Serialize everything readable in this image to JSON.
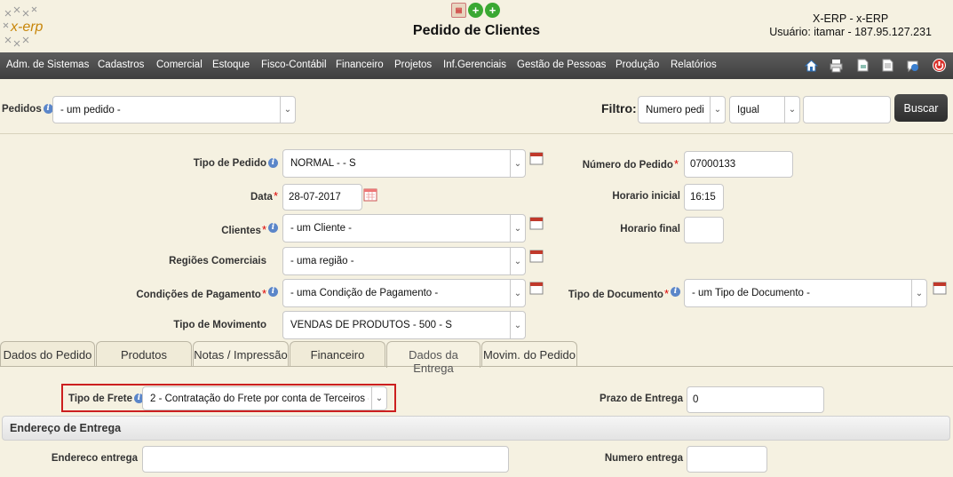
{
  "header": {
    "logo_text": "x-erp",
    "title": "Pedido de Clientes",
    "system_name": "X-ERP - x-ERP",
    "user_line": "Usuário: itamar - 187.95.127.231"
  },
  "menu": {
    "items": [
      "Adm. de Sistemas",
      "Cadastros",
      "Comercial",
      "Estoque",
      "Fisco-Contábil",
      "Financeiro",
      "Projetos",
      "Inf.Gerenciais",
      "Gestão de Pessoas",
      "Produção",
      "Relatórios"
    ]
  },
  "toolbar": {
    "icons": [
      "home-icon",
      "print-icon",
      "export-icon",
      "document-icon",
      "help-icon",
      "exit-icon"
    ]
  },
  "search": {
    "pedidos_label": "Pedidos",
    "pedidos_value": "- um pedido -",
    "filtro_label": "Filtro:",
    "filtro_field": "Numero pedi",
    "filtro_operator": "Igual",
    "filtro_value": "",
    "buscar_label": "Buscar"
  },
  "form": {
    "tipo_pedido_label": "Tipo de Pedido",
    "tipo_pedido_value": "NORMAL - - S",
    "data_label": "Data",
    "data_value": "28-07-2017",
    "clientes_label": "Clientes",
    "clientes_value": "- um Cliente -",
    "regioes_label": "Regiões Comerciais",
    "regioes_value": "- uma região -",
    "condicoes_label": "Condições de Pagamento",
    "condicoes_value": "- uma Condição de Pagamento -",
    "tipo_movimento_label": "Tipo de Movimento",
    "tipo_movimento_value": "VENDAS DE PRODUTOS - 500 - S",
    "numero_pedido_label": "Número do Pedido",
    "numero_pedido_value": "07000133",
    "horario_inicial_label": "Horario inicial",
    "horario_inicial_value": "16:15",
    "horario_final_label": "Horario final",
    "horario_final_value": "",
    "tipo_documento_label": "Tipo de Documento",
    "tipo_documento_value": "- um Tipo de Documento -"
  },
  "tabs": [
    {
      "label": "Dados do Pedido"
    },
    {
      "label": "Produtos"
    },
    {
      "label": "Notas / Impressão"
    },
    {
      "label": "Financeiro"
    },
    {
      "label": "Dados da Entrega"
    },
    {
      "label": "Movim. do Pedido"
    }
  ],
  "entrega": {
    "tipo_frete_label": "Tipo de Frete",
    "tipo_frete_value": "2 - Contratação do Frete por conta de Terceiros -",
    "prazo_label": "Prazo de Entrega",
    "prazo_value": "0",
    "section_title": "Endereço de Entrega",
    "endereco_label": "Endereco entrega",
    "endereco_value": "",
    "numero_label": "Numero entrega",
    "numero_value": ""
  },
  "colors": {
    "menubar": "#4a4a4a",
    "background": "#f5f1e1",
    "required": "#dd0000",
    "highlight": "#cc0000"
  }
}
